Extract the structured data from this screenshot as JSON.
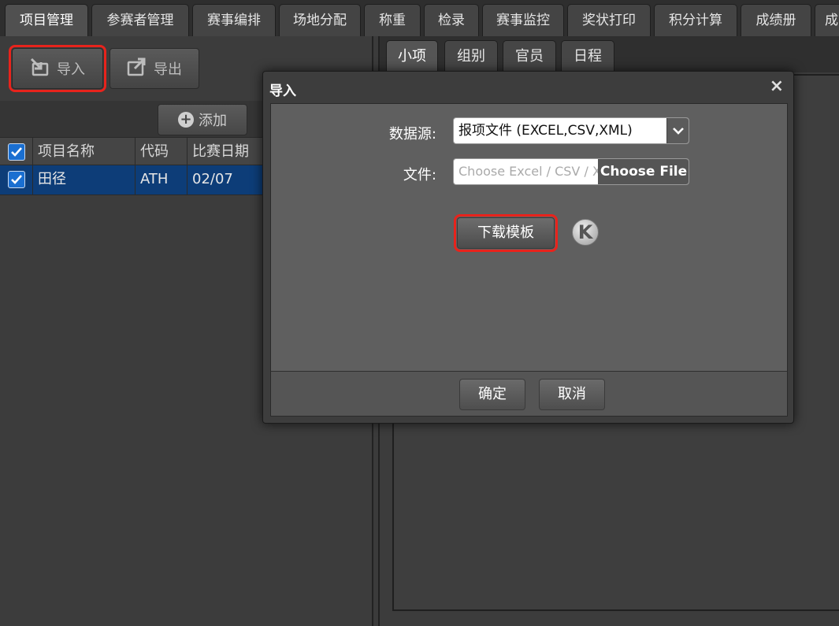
{
  "top_tabs": [
    {
      "label": "项目管理"
    },
    {
      "label": "参赛者管理"
    },
    {
      "label": "赛事编排"
    },
    {
      "label": "场地分配"
    },
    {
      "label": "称重"
    },
    {
      "label": "检录"
    },
    {
      "label": "赛事监控"
    },
    {
      "label": "奖状打印"
    },
    {
      "label": "积分计算"
    },
    {
      "label": "成绩册"
    },
    {
      "label": "成"
    }
  ],
  "toolbar": {
    "import_label": "导入",
    "export_label": "导出",
    "add_label": "添加"
  },
  "grid": {
    "headers": [
      "项目名称",
      "代码",
      "比赛日期"
    ],
    "rows": [
      {
        "name": "田径",
        "code": "ATH",
        "date": "02/07"
      }
    ]
  },
  "sub_tabs": [
    {
      "label": "小项"
    },
    {
      "label": "组别"
    },
    {
      "label": "官员"
    },
    {
      "label": "日程"
    }
  ],
  "dialog": {
    "title": "导入",
    "close": "×",
    "source_label": "数据源:",
    "source_value": "报项文件 (EXCEL,CSV,XML)",
    "file_label": "文件:",
    "file_placeholder": "Choose Excel / CSV / XML",
    "file_button": "Choose File",
    "download_label": "下载模板",
    "ok_label": "确定",
    "cancel_label": "取消"
  },
  "colors": {
    "highlight": "#e8231c",
    "selected_row": "#0d3d78",
    "checkbox": "#1a6fd1"
  }
}
